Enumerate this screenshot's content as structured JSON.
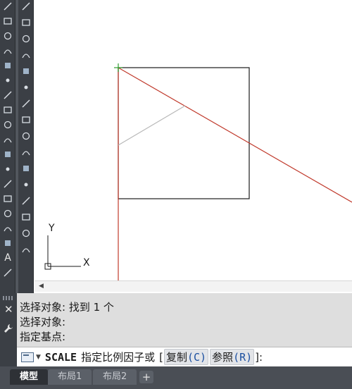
{
  "toolbar_left": {
    "tools": [
      "line-icon",
      "xline-icon",
      "polyline-icon",
      "polygon-icon",
      "rectangle-icon",
      "arc-icon",
      "circle-icon",
      "revcloud-icon",
      "spline-icon",
      "ellipse-icon",
      "insert-block-icon",
      "make-block-icon",
      "point-icon",
      "hatch-icon",
      "gradient-icon",
      "region-icon",
      "table-icon",
      "text-icon",
      "add-selected-icon"
    ],
    "text_tool_label": "A"
  },
  "toolbar_right": {
    "tools": [
      "erase-icon",
      "copy-icon",
      "mirror-icon",
      "offset-icon",
      "array-icon",
      "move-icon",
      "rotate-icon",
      "scale-icon",
      "stretch-icon",
      "trim-icon",
      "extend-icon",
      "break-icon",
      "join-icon",
      "chamfer-icon",
      "fillet-icon",
      "explode-icon"
    ]
  },
  "ucs": {
    "x_label": "X",
    "y_label": "Y"
  },
  "command": {
    "history": [
      "选择对象: 找到 1 个",
      "选择对象:",
      "指定基点:"
    ],
    "current_command": "SCALE",
    "prompt_text": "指定比例因子或",
    "option_copy": {
      "label": "复制",
      "key": "(C)"
    },
    "option_reference": {
      "label": "参照",
      "key": "(R)"
    },
    "bracket_open": "[",
    "bracket_close": "]:"
  },
  "tabs": [
    {
      "label": "模型",
      "active": true
    },
    {
      "label": "布局1",
      "active": false
    },
    {
      "label": "布局2",
      "active": false
    }
  ],
  "tab_add_label": "+",
  "colors": {
    "accent_red": "#c0392b",
    "object_black": "#1a1a1a",
    "crosshair_green": "#2e9e2e",
    "option_blue": "#1b4fa0"
  }
}
